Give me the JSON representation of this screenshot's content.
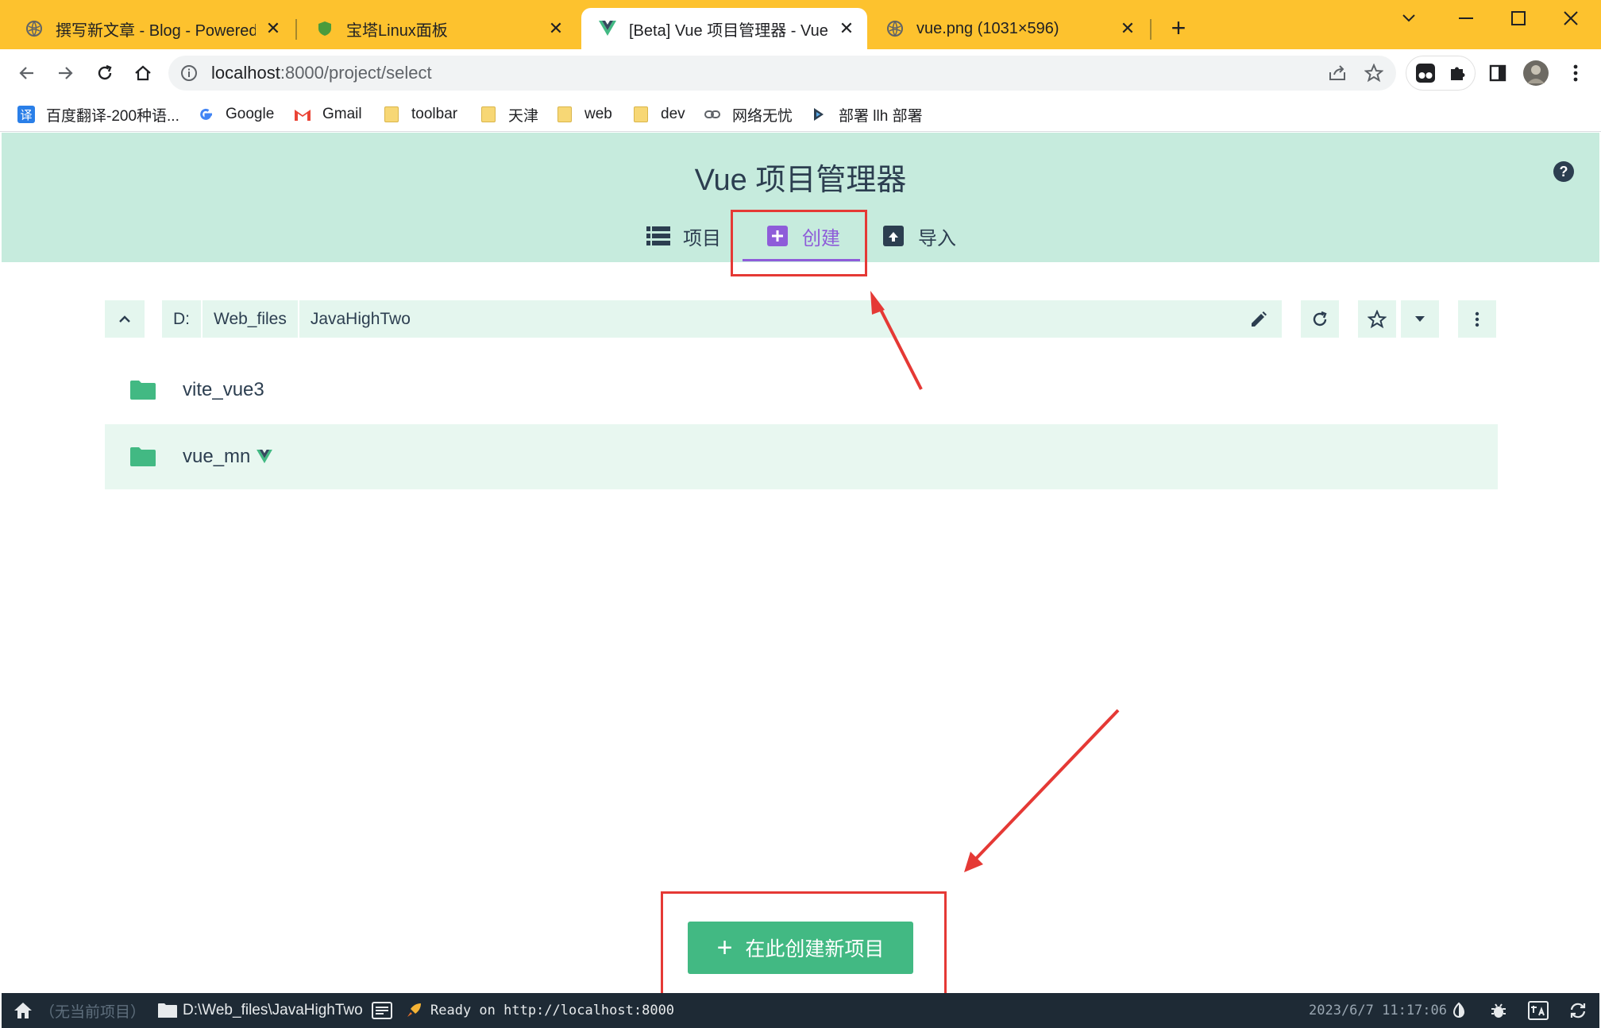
{
  "browser": {
    "tabs": [
      {
        "title": "撰写新文章 - Blog - Powered by",
        "active": false
      },
      {
        "title": "宝塔Linux面板",
        "active": false
      },
      {
        "title": "[Beta] Vue 项目管理器 - Vue CLI",
        "active": true
      },
      {
        "title": "vue.png (1031×596)",
        "active": false
      }
    ],
    "new_tab_label": "+",
    "url_host": "localhost",
    "url_rest": ":8000/project/select",
    "bookmarks": [
      {
        "label": "百度翻译-200种语..."
      },
      {
        "label": "Google"
      },
      {
        "label": "Gmail"
      },
      {
        "label": "toolbar"
      },
      {
        "label": "天津"
      },
      {
        "label": "web"
      },
      {
        "label": "dev"
      },
      {
        "label": "网络无忧"
      },
      {
        "label": "部署 llh 部署"
      }
    ],
    "translate_icon_label": "译"
  },
  "app": {
    "title": "Vue 项目管理器",
    "help_label": "?",
    "nav": [
      {
        "label": "项目"
      },
      {
        "label": "创建"
      },
      {
        "label": "导入"
      }
    ],
    "path": [
      "D:",
      "Web_files",
      "JavaHighTwo"
    ],
    "folders": [
      {
        "name": "vite_vue3",
        "highlighted": false,
        "vue": false
      },
      {
        "name": "vue_mn",
        "highlighted": true,
        "vue": true
      }
    ],
    "create_button": {
      "label": "在此创建新项目",
      "icon": "+"
    }
  },
  "statusbar": {
    "current_project": "（无当前项目）",
    "cwd": "D:\\Web_files\\JavaHighTwo",
    "log": "Ready on http://localhost:8000",
    "datetime": "2023/6/7 11:17:06"
  },
  "colors": {
    "tabstrip": "#fdc22e",
    "header_bg": "#c6ebdd",
    "accent_green": "#42b983",
    "accent_purple": "#8e5cd9",
    "text_dark": "#2c3e50",
    "statusbar_bg": "#1e2a35",
    "annotation_red": "#e53935"
  }
}
